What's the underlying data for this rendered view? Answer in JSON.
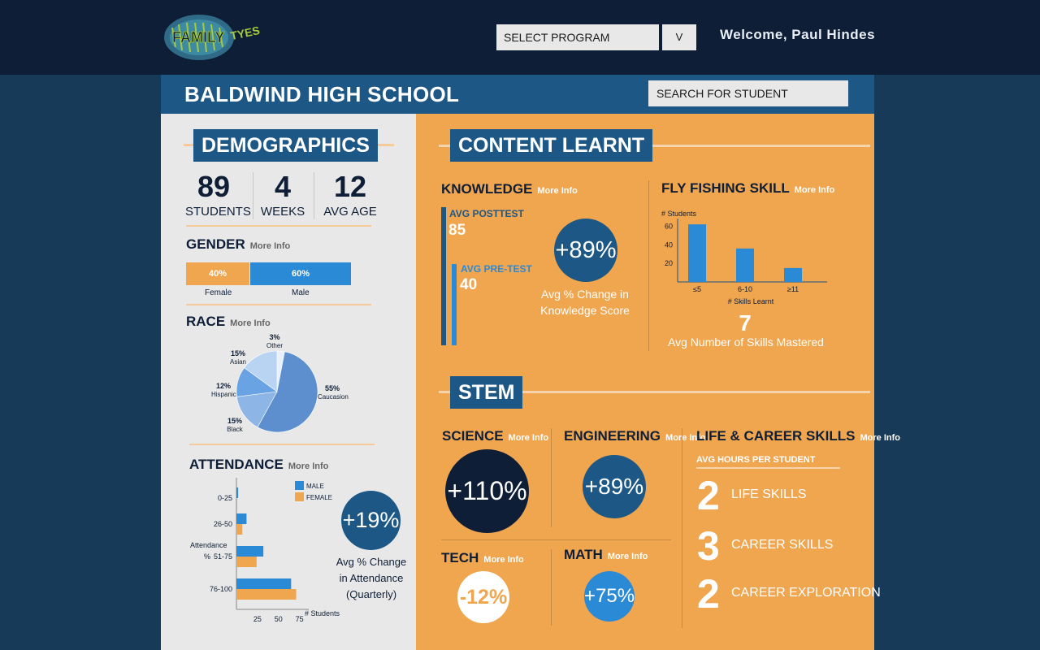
{
  "header": {
    "logo_text": "FAMILY TYES",
    "select_program": "SELECT PROGRAM",
    "select_caret": "V",
    "welcome": "Welcome, Paul Hindes"
  },
  "school": {
    "title": "BALDWIND HIGH SCHOOL",
    "search_placeholder": "SEARCH FOR STUDENT"
  },
  "demographics": {
    "title": "DEMOGRAPHICS",
    "stats": [
      {
        "num": "89",
        "label": "STUDENTS"
      },
      {
        "num": "4",
        "label": "WEEKS"
      },
      {
        "num": "12",
        "label": "AVG AGE"
      }
    ],
    "gender": {
      "title": "GENDER",
      "more": "More Info",
      "female_pct": "40%",
      "male_pct": "60%",
      "female_label": "Female",
      "male_label": "Male"
    },
    "race": {
      "title": "RACE",
      "more": "More Info",
      "slices": [
        {
          "pct": "3%",
          "label": "Other"
        },
        {
          "pct": "15%",
          "label": "Asian"
        },
        {
          "pct": "12%",
          "label": "Hispanic"
        },
        {
          "pct": "15%",
          "label": "Black"
        },
        {
          "pct": "55%",
          "label": "Caucasion"
        }
      ]
    },
    "attendance": {
      "title": "ATTENDANCE",
      "more": "More Info",
      "legend_male": "MALE",
      "legend_female": "FEMALE",
      "ylabel_a": "Attendance",
      "ylabel_b": "%",
      "xlabel": "# Students",
      "categories": [
        "0-25",
        "26-50",
        "51-75",
        "76-100"
      ],
      "ticks": [
        "25",
        "50",
        "75"
      ],
      "change": "+19%",
      "change_label_1": "Avg % Change",
      "change_label_2": "in Attendance",
      "change_label_3": "(Quarterly)"
    }
  },
  "content": {
    "title": "CONTENT LEARNT",
    "knowledge": {
      "title": "KNOWLEDGE",
      "more": "More Info",
      "posttest_label": "AVG POSTTEST",
      "posttest_value": "85",
      "pretest_label": "AVG PRE-TEST",
      "pretest_value": "40",
      "change": "+89%",
      "change_label_1": "Avg % Change in",
      "change_label_2": "Knowledge Score"
    },
    "fly": {
      "title": "FLY FISHING SKILL",
      "more": "More Info",
      "ylabel": "# Students",
      "xlabel": "# Skills Learnt",
      "yticks": [
        "60",
        "40",
        "20"
      ],
      "avg_value": "7",
      "avg_label": "Avg Number of Skills Mastered"
    }
  },
  "stem": {
    "title": "STEM",
    "science": {
      "title": "SCIENCE",
      "more": "More Info",
      "value": "+110%"
    },
    "engineering": {
      "title": "ENGINEERING",
      "more": "More Info",
      "value": "+89%"
    },
    "tech": {
      "title": "TECH",
      "more": "More Info",
      "value": "-12%"
    },
    "math": {
      "title": "MATH",
      "more": "More Info",
      "value": "+75%"
    },
    "life": {
      "title": "LIFE & CAREER SKILLS",
      "more": "More Info",
      "subtitle": "AVG HOURS PER STUDENT",
      "items": [
        {
          "num": "2",
          "label": "LIFE SKILLS"
        },
        {
          "num": "3",
          "label": "CAREER SKILLS"
        },
        {
          "num": "2",
          "label": "CAREER EXPLORATION"
        }
      ]
    }
  },
  "colors": {
    "navy": "#0e1e36",
    "blue": "#1d5785",
    "bright_blue": "#2b8ad6",
    "orange": "#f0a54f",
    "panel_gray": "#e8e8e8"
  },
  "chart_data": [
    {
      "type": "pie",
      "categories": [
        "Caucasion",
        "Black",
        "Hispanic",
        "Asian",
        "Other"
      ],
      "values": [
        55,
        15,
        12,
        15,
        3
      ]
    },
    {
      "type": "bar",
      "categories": [
        "0-25",
        "26-50",
        "51-75",
        "76-100"
      ],
      "series": [
        {
          "name": "MALE",
          "values": [
            2,
            12,
            32,
            65
          ]
        },
        {
          "name": "FEMALE",
          "values": [
            1,
            7,
            24,
            71
          ]
        }
      ],
      "xlabel": "# Students",
      "ylabel": "Attendance %",
      "xlim": [
        0,
        85
      ]
    },
    {
      "type": "bar",
      "categories": [
        "≤5",
        "6-10",
        "≥11"
      ],
      "values": [
        62,
        36,
        15
      ],
      "xlabel": "# Skills Learnt",
      "ylabel": "# Students",
      "ylim": [
        0,
        70
      ]
    }
  ]
}
